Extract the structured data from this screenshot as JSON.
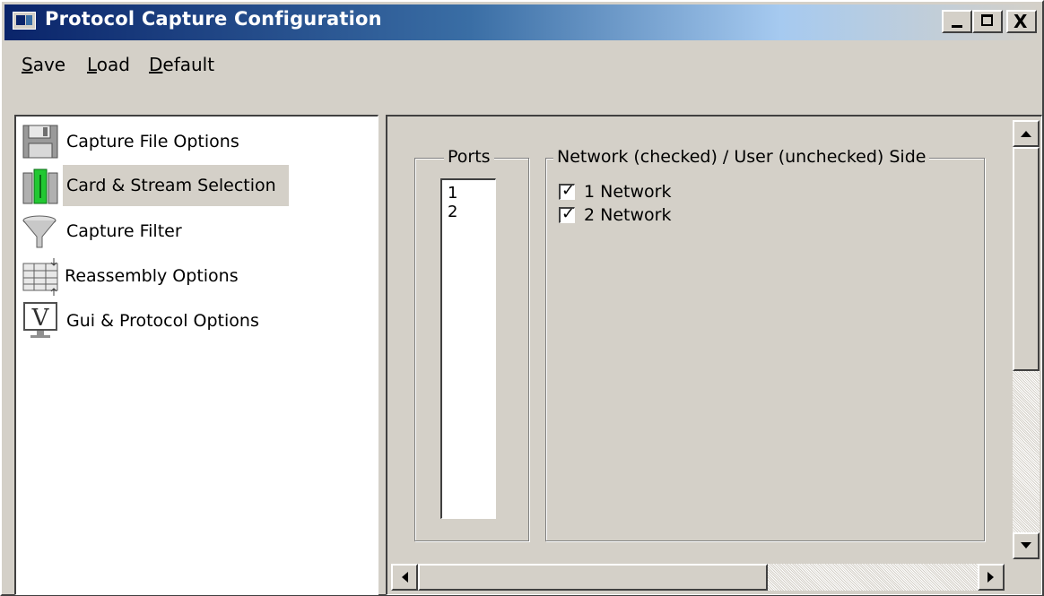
{
  "window": {
    "title": "Protocol Capture Configuration",
    "controls": {
      "minimize": "_",
      "maximize": "□",
      "close": "X"
    }
  },
  "menu": {
    "items": [
      {
        "label": "Save",
        "accel": "S",
        "rest": "ave"
      },
      {
        "label": "Load",
        "accel": "L",
        "rest": "oad"
      },
      {
        "label": "Default",
        "accel": "D",
        "rest": "efault"
      }
    ]
  },
  "sidebar": {
    "items": [
      {
        "label": "Capture File Options",
        "icon": "floppy-disk-icon",
        "selected": false
      },
      {
        "label": "Card & Stream Selection",
        "icon": "card-stream-icon",
        "selected": true
      },
      {
        "label": "Capture Filter",
        "icon": "funnel-icon",
        "selected": false
      },
      {
        "label": "Reassembly Options",
        "icon": "reassembly-icon",
        "selected": false
      },
      {
        "label": "Gui & Protocol Options",
        "icon": "gui-protocol-icon",
        "selected": false
      }
    ]
  },
  "ports": {
    "group_label": "Ports",
    "items": [
      "1",
      "2"
    ]
  },
  "side": {
    "group_label": "Network (checked) / User (unchecked) Side",
    "items": [
      {
        "label": "1 Network",
        "checked": true
      },
      {
        "label": "2 Network",
        "checked": true
      }
    ]
  },
  "colors": {
    "titlebar_start": "#0a246a",
    "titlebar_end": "#d4d0c8",
    "face": "#d4d0c8",
    "selected_icon_accent": "#22c832"
  }
}
